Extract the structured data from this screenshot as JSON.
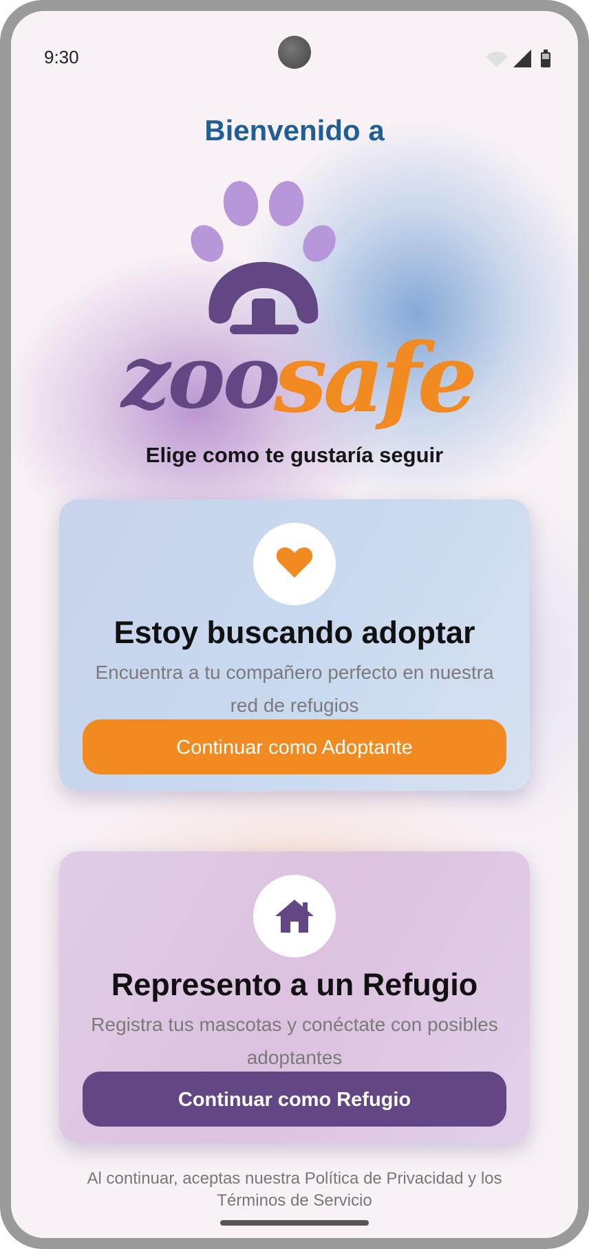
{
  "status": {
    "time": "9:30",
    "icons": [
      "wifi-icon",
      "signal-icon",
      "battery-icon"
    ]
  },
  "header": {
    "welcome": "Bienvenido a",
    "logo_text": "zoosafe"
  },
  "prompt": "Elige como te gustaría seguir",
  "cards": [
    {
      "icon": "heart-icon",
      "title": "Estoy buscando adoptar",
      "description": "Encuentra a tu compañero perfecto en nuestra red de refugios",
      "button": "Continuar como Adoptante"
    },
    {
      "icon": "house-icon",
      "title": "Represento a un Refugio",
      "description": "Registra tus mascotas y conéctate con posibles adoptantes",
      "button": "Continuar como Refugio"
    }
  ],
  "legal": "Al continuar, aceptas nuestra Política de Privacidad y los Términos de Servicio",
  "colors": {
    "primary_orange": "#f28a22",
    "primary_purple": "#634684",
    "welcome_blue": "#1f5f96",
    "paw_light": "#b796d9"
  }
}
